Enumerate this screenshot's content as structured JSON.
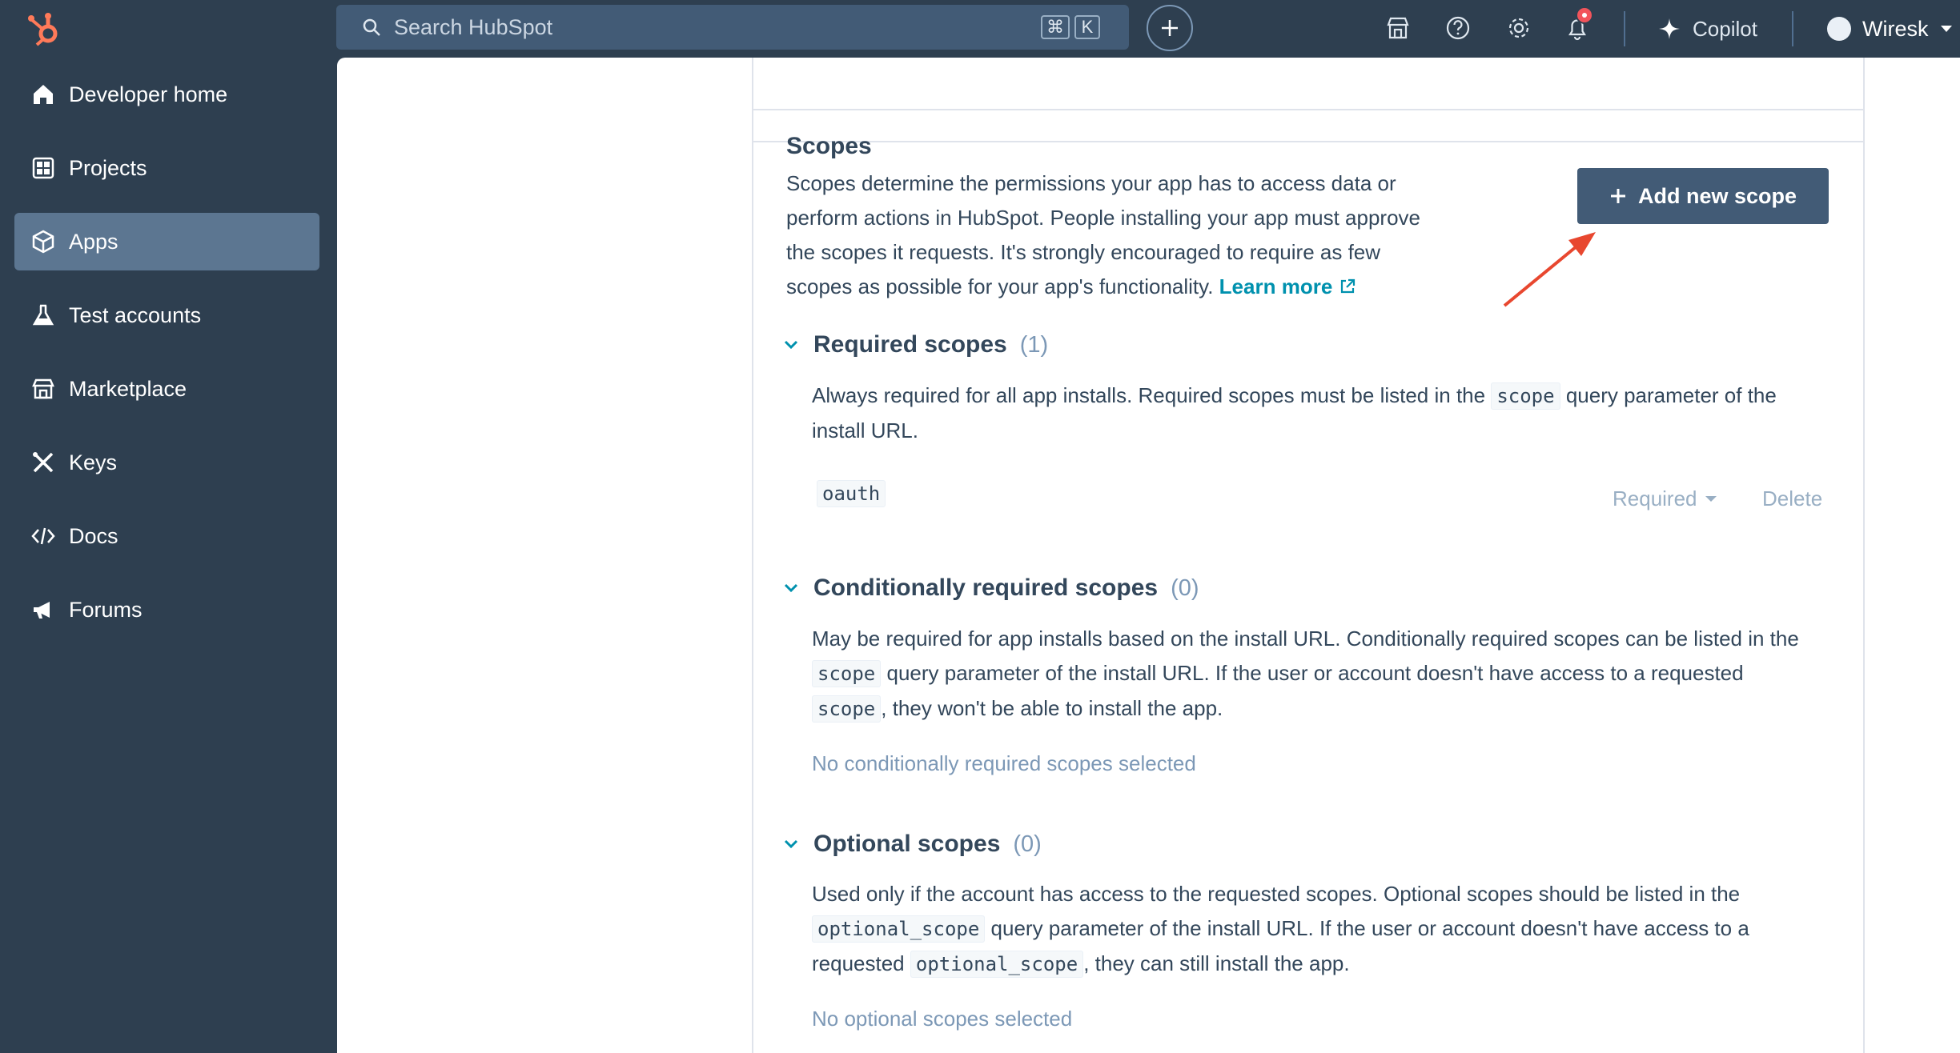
{
  "topbar": {
    "search_placeholder": "Search HubSpot",
    "shortcut_keys": [
      "⌘",
      "K"
    ],
    "copilot_label": "Copilot",
    "account_name": "Wiresk"
  },
  "sidebar": {
    "items": [
      {
        "label": "Developer home",
        "icon": "home-icon"
      },
      {
        "label": "Projects",
        "icon": "projects-icon"
      },
      {
        "label": "Apps",
        "icon": "apps-icon",
        "active": true
      },
      {
        "label": "Test accounts",
        "icon": "flask-icon"
      },
      {
        "label": "Marketplace",
        "icon": "store-icon"
      },
      {
        "label": "Keys",
        "icon": "keys-icon"
      },
      {
        "label": "Docs",
        "icon": "code-icon"
      },
      {
        "label": "Forums",
        "icon": "megaphone-icon"
      }
    ]
  },
  "scopes": {
    "title": "Scopes",
    "intro_lines": [
      "Scopes determine the permissions your app has to access data or",
      "perform actions in HubSpot. People installing your app must approve",
      "the scopes it requests. It's strongly encouraged to require as few",
      "scopes as possible for your app's functionality."
    ],
    "learn_more": "Learn more",
    "add_button": "Add new scope",
    "required": {
      "title": "Required scopes",
      "count": "(1)",
      "desc_a": "Always required for all app installs. Required scopes must be listed in the",
      "desc_code": "scope",
      "desc_b": "query parameter of the",
      "desc_c": "install URL.",
      "scope_name": "oauth",
      "select_value": "Required",
      "delete_label": "Delete"
    },
    "conditional": {
      "title": "Conditionally required scopes",
      "count": "(0)",
      "desc_a": "May be required for app installs based on the install URL. Conditionally required scopes can be listed in the",
      "code1": "scope",
      "desc_b": "query parameter of the install URL. If the user or account doesn't have access to a requested",
      "code2": "scope",
      "desc_c": ", they won't be able to install the app.",
      "empty": "No conditionally required scopes selected"
    },
    "optional": {
      "title": "Optional scopes",
      "count": "(0)",
      "desc_a": "Used only if the account has access to the requested scopes. Optional scopes should be listed in the",
      "code1": "optional_scope",
      "desc_b": "query parameter of the install URL. If the user or account doesn't have access to a",
      "desc_c": "requested",
      "code2": "optional_scope",
      "desc_d": ", they can still install the app.",
      "empty": "No optional scopes selected"
    }
  },
  "colors": {
    "nav_bg": "#2e3f50",
    "active_item": "#5c7691",
    "button": "#425b76",
    "link": "#0091ae",
    "annotation_arrow": "#e8472f",
    "brand": "#ff7a59"
  }
}
